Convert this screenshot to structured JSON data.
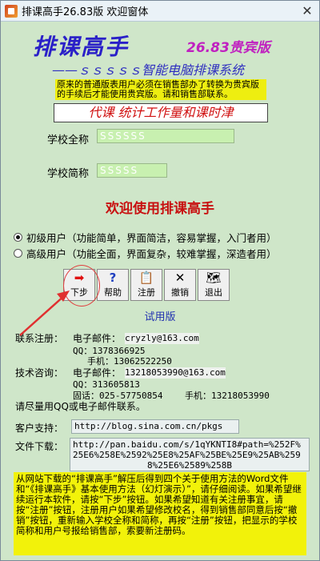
{
  "window": {
    "title": "排课高手26.83版 欢迎窗体",
    "close": "✕"
  },
  "header": {
    "headline": "排课高手",
    "version": "26.83贵宾版",
    "subtitle": "——ｓｓｓｓｓ智能电脑排课系统"
  },
  "notice": "原来的普通版表用户必须在销售部办了转换为贵宾版的手续后才能使用贵宾版。请和销售部联系。",
  "banner": "代课   统计工作量和课时津",
  "school": {
    "full_name_label": "学校全称",
    "full_name_value": "SSSSSS",
    "short_name_label": "学校简称",
    "short_name_value": "SSSSS"
  },
  "welcome": "欢迎使用排课高手",
  "user_levels": [
    {
      "label": "初级用户（功能简单，界面简洁，容易掌握，入门者用）",
      "selected": true
    },
    {
      "label": "高级用户（功能全面，界面复杂，较难掌握，深造者用）",
      "selected": false
    }
  ],
  "toolbar": [
    {
      "label": "下步",
      "icon": "➡"
    },
    {
      "label": "帮助",
      "icon": "?"
    },
    {
      "label": "注册",
      "icon": "📋"
    },
    {
      "label": "撤销",
      "icon": "✕"
    },
    {
      "label": "退出",
      "icon": "🗺"
    }
  ],
  "trial": "试用版",
  "contact": {
    "reg_label": "联系注册：",
    "email_label": "电子邮件：",
    "email": "cryzly@163.com",
    "qq": "QQ：1378366925",
    "phone": "手机：13062522250",
    "tech_label": "技术咨询：",
    "tech_email_label": "电子邮件：",
    "tech_email": "13218053990@163.com",
    "tech_qq": "QQ：313605813",
    "tech_fixed": "固话：025-57750854",
    "tech_mobile": "手机：13218053990",
    "tip": "请尽量用QQ或电子邮件联系。"
  },
  "support": {
    "label": "客户支持：",
    "url": "http://blog.sina.com.cn/pkgs"
  },
  "download": {
    "label": "文件下载：",
    "url_line1": "http://pan.baidu.com/s/1qYKNTI8#path=%252F%",
    "url_line2": "25E6%258E%2592%25E8%25AF%25BE%25E9%25AB%259",
    "url_line3": "8%25E6%2589%258B"
  },
  "footer": "从网站下载的“排课高手”解压后得到四个关于使用方法的Word文件和“《排课高手》基本使用方法（幻灯演示）”，请仔细阅读。如果希望继续运行本软件，请按“下步”按钮。如果希望知道有关注册事宜，请按“注册”按钮，注册用户如果希望修改校名，得到销售部同意后按“撤销”按钮，重新输入学校全称和简称，再按“注册”按钮，把显示的学校简称和用户号报给销售部，索要新注册码。"
}
